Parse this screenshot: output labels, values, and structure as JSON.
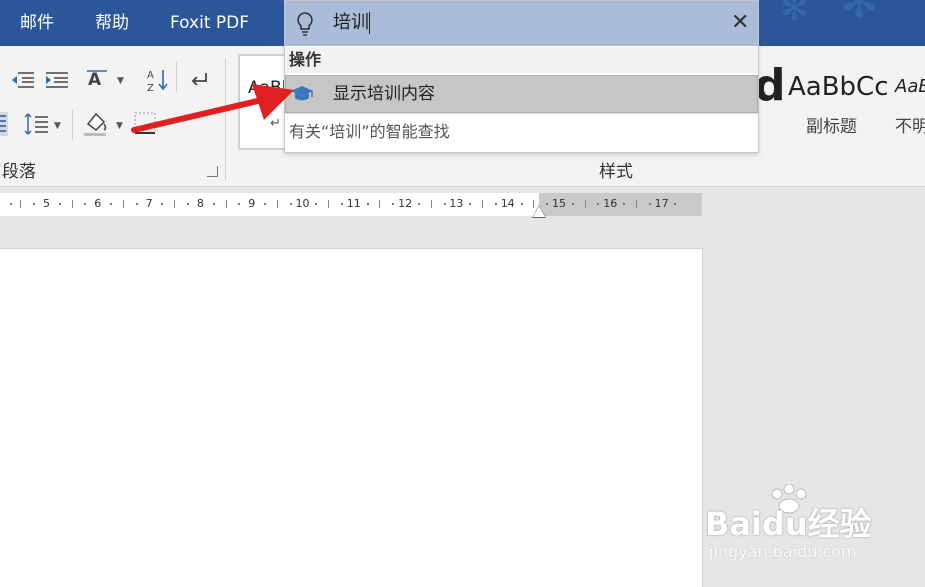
{
  "tabs": {
    "mail": "邮件",
    "help": "帮助",
    "foxit": "Foxit PDF"
  },
  "ribbon": {
    "paragraph_group": "段落",
    "styles_group": "样式",
    "style_cards": [
      {
        "sample": "AaBl",
        "name": ""
      },
      {
        "sample": "AaBbCc",
        "name": "副标题"
      },
      {
        "sample": "AaB",
        "name": "不明"
      }
    ],
    "big_glyph": "d"
  },
  "ruler": {
    "numbers": [
      "5",
      "6",
      "7",
      "8",
      "9",
      "10",
      "11",
      "12",
      "13",
      "14",
      "15",
      "16",
      "17"
    ]
  },
  "search_popup": {
    "query": "培训",
    "section_header": "操作",
    "result_label": "显示培训内容",
    "smart_lookup": "有关“培训”的智能查找"
  },
  "watermark": {
    "brand": "Baidu经验",
    "url": "jingyan.baidu.com"
  },
  "colors": {
    "title_bar": "#2b579a",
    "search_field": "#a9bcd9",
    "highlight_row": "#c6c6c6",
    "arrow": "#e02020",
    "result_icon": "#3b76b8"
  },
  "icons": [
    "lightbulb-icon",
    "close-icon",
    "graduation-cap-icon",
    "decrease-indent-icon",
    "increase-indent-icon",
    "text-direction-icon",
    "sort-icon",
    "show-marks-icon",
    "align-justify-icon",
    "line-spacing-icon",
    "shading-icon",
    "borders-icon",
    "dialog-launcher-icon"
  ]
}
